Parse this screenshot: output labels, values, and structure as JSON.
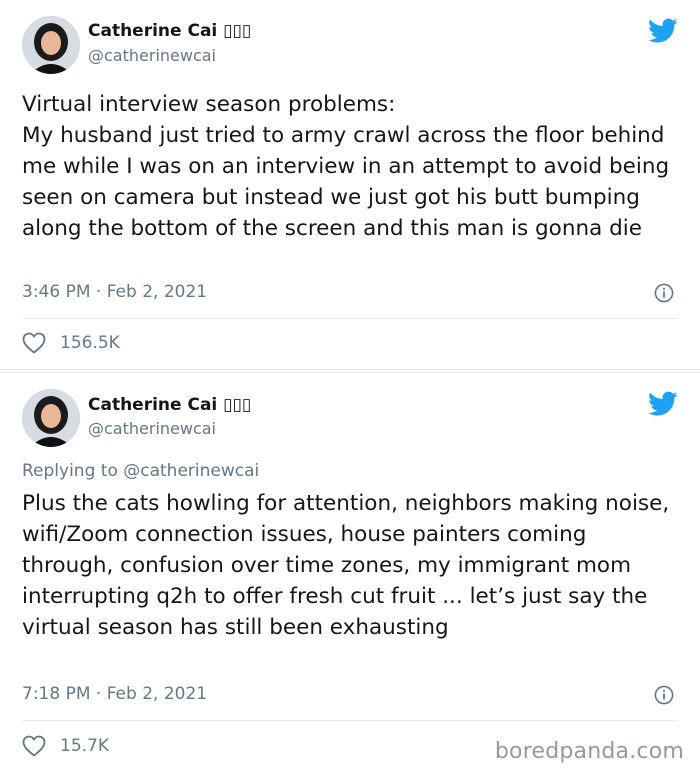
{
  "tweets": [
    {
      "display_name": "Catherine Cai ▯▯▯",
      "handle": "@catherinewcai",
      "text": "Virtual interview season problems:\nMy husband just tried to army crawl across the floor behind me while I was on an interview in an attempt to avoid being seen on camera but instead we just got his butt bumping along the bottom of the screen and this man is gonna die",
      "timestamp": "3:46 PM · Feb 2, 2021",
      "likes": "156.5K"
    },
    {
      "display_name": "Catherine Cai ▯▯▯",
      "handle": "@catherinewcai",
      "replying_prefix": "Replying to",
      "replying_to": "@catherinewcai",
      "text": "Plus the cats howling for attention, neighbors making noise, wifi/Zoom connection issues, house painters coming through, confusion over time zones, my immigrant mom interrupting q2h to offer fresh cut fruit ... let’s just say the virtual season has still been exhausting",
      "timestamp": "7:18 PM · Feb 2, 2021",
      "likes": "15.7K"
    }
  ],
  "watermark": "boredpanda.com",
  "colors": {
    "twitter_blue": "#1da1f2",
    "secondary_text": "#657786",
    "primary_text": "#14171a",
    "divider": "#e6ecf0"
  },
  "icons": [
    "twitter-bird-icon",
    "info-icon",
    "heart-icon"
  ]
}
